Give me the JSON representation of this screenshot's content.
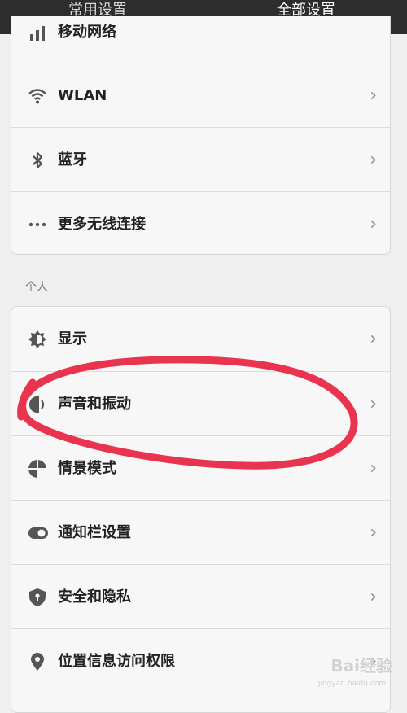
{
  "tabs": [
    {
      "label": "常用设置"
    },
    {
      "label": "全部设置"
    }
  ],
  "wireless": {
    "items": [
      {
        "label": "移动网络",
        "icon": "signal-icon"
      },
      {
        "label": "WLAN",
        "icon": "wifi-icon"
      },
      {
        "label": "蓝牙",
        "icon": "bluetooth-icon"
      },
      {
        "label": "更多无线连接",
        "icon": "more-dots-icon"
      }
    ]
  },
  "personal": {
    "section_title": "个人",
    "items": [
      {
        "label": "显示",
        "icon": "brightness-icon"
      },
      {
        "label": "声音和振动",
        "icon": "speaker-icon"
      },
      {
        "label": "情景模式",
        "icon": "profile-mode-icon"
      },
      {
        "label": "通知栏设置",
        "icon": "toggle-icon"
      },
      {
        "label": "安全和隐私",
        "icon": "shield-lock-icon"
      },
      {
        "label": "位置信息访问权限",
        "icon": "location-pin-icon"
      }
    ]
  },
  "chevron": "›",
  "annotation_color": "#e8344f",
  "watermark": {
    "text": "Bai经验",
    "sub": "jingyan.baidu.com"
  }
}
